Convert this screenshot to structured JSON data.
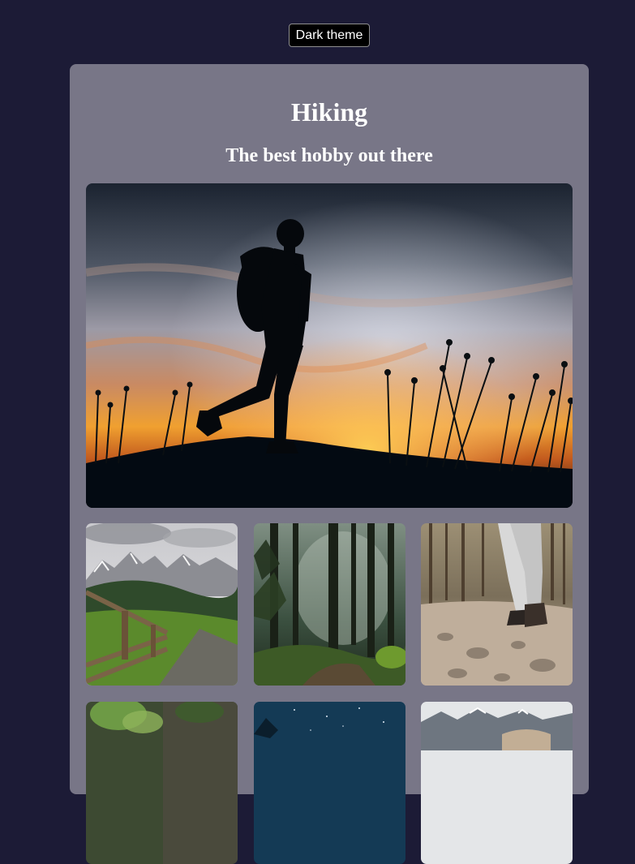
{
  "header": {
    "theme_button_label": "Dark theme"
  },
  "card": {
    "title": "Hiking",
    "subtitle": "The best hobby out there"
  },
  "gallery": {
    "hero_image": "hiker-silhouette-sunset",
    "thumbnails": [
      "mountain-meadow-fence",
      "misty-forest",
      "hiker-legs-rocky-trail",
      "mossy-rocks",
      "starry-night-sky",
      "snowy-mountains"
    ]
  }
}
